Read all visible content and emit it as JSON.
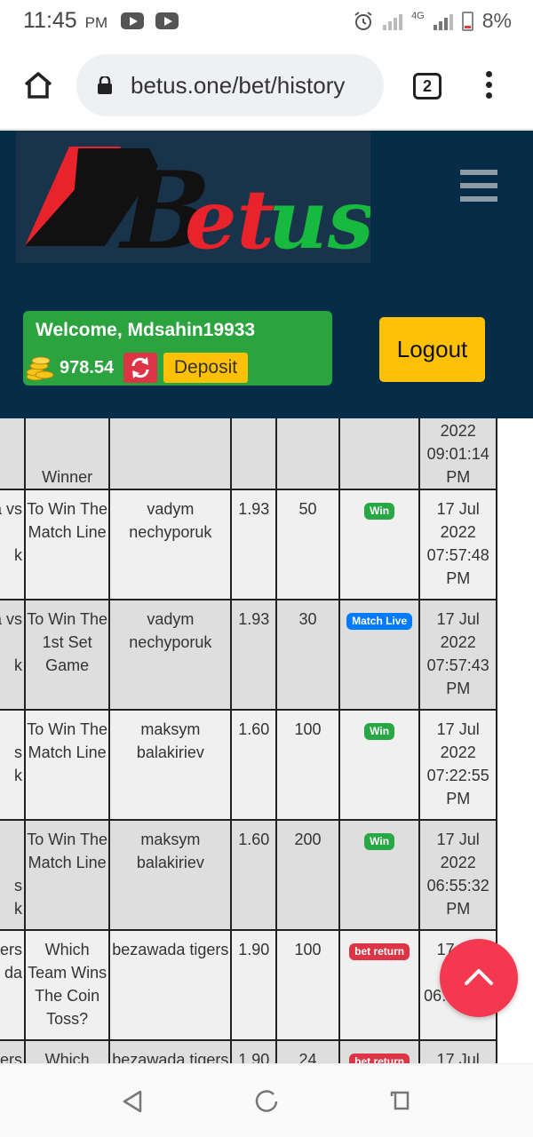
{
  "status_bar": {
    "time": "11:45",
    "ampm": "PM",
    "network": "4G",
    "battery": "8%"
  },
  "browser": {
    "url": "betus.one/bet/history",
    "tab_count": "2"
  },
  "site": {
    "logo_text": "Betus",
    "welcome": "Welcome, Mdsahin19933",
    "balance": "978.54",
    "deposit_label": "Deposit",
    "logout_label": "Logout"
  },
  "bets": [
    {
      "event": "",
      "market": "Winner",
      "selection": "",
      "odds": "",
      "stake": "",
      "status": "",
      "status_type": "",
      "date": "2022\n09:01:14\nPM"
    },
    {
      "event": "a vs\n\nk",
      "market": "To Win The Match Line",
      "selection": "vadym nechyporuk",
      "odds": "1.93",
      "stake": "50",
      "status": "Win",
      "status_type": "win",
      "date": "17 Jul 2022 07:57:48 PM"
    },
    {
      "event": "a vs\n\nk",
      "market": "To Win The 1st Set Game",
      "selection": "vadym nechyporuk",
      "odds": "1.93",
      "stake": "30",
      "status": "Match Live",
      "status_type": "live",
      "date": "17 Jul 2022 07:57:43 PM"
    },
    {
      "event": "\ns\nk",
      "market": "To Win The Match Line",
      "selection": "maksym balakiriev",
      "odds": "1.60",
      "stake": "100",
      "status": "Win",
      "status_type": "win",
      "date": "17 Jul 2022 07:22:55 PM"
    },
    {
      "event": "\n\ns\nk",
      "market": "To Win The Match Line",
      "selection": "maksym balakiriev",
      "odds": "1.60",
      "stake": "200",
      "status": "Win",
      "status_type": "win",
      "date": "17 Jul 2022 06:55:32 PM"
    },
    {
      "event": "ers\nda",
      "market": "Which Team Wins The Coin Toss?",
      "selection": "bezawada tigers",
      "odds": "1.90",
      "stake": "100",
      "status": "bet return",
      "status_type": "ret",
      "date": "17 Jul 2022 06:56 PM"
    },
    {
      "event": "ers",
      "market": "Which",
      "selection": "bezawada tigers",
      "odds": "1.90",
      "stake": "24",
      "status": "bet return",
      "status_type": "ret",
      "date": "17 Jul"
    }
  ],
  "colors": {
    "header_bg": "#062c48",
    "welcome_bg": "#2ba33f",
    "deposit_bg": "#ffc107",
    "badge_win": "#28a745",
    "badge_live": "#007bff",
    "badge_return": "#dc3545",
    "fab_bg": "#f3384f"
  }
}
